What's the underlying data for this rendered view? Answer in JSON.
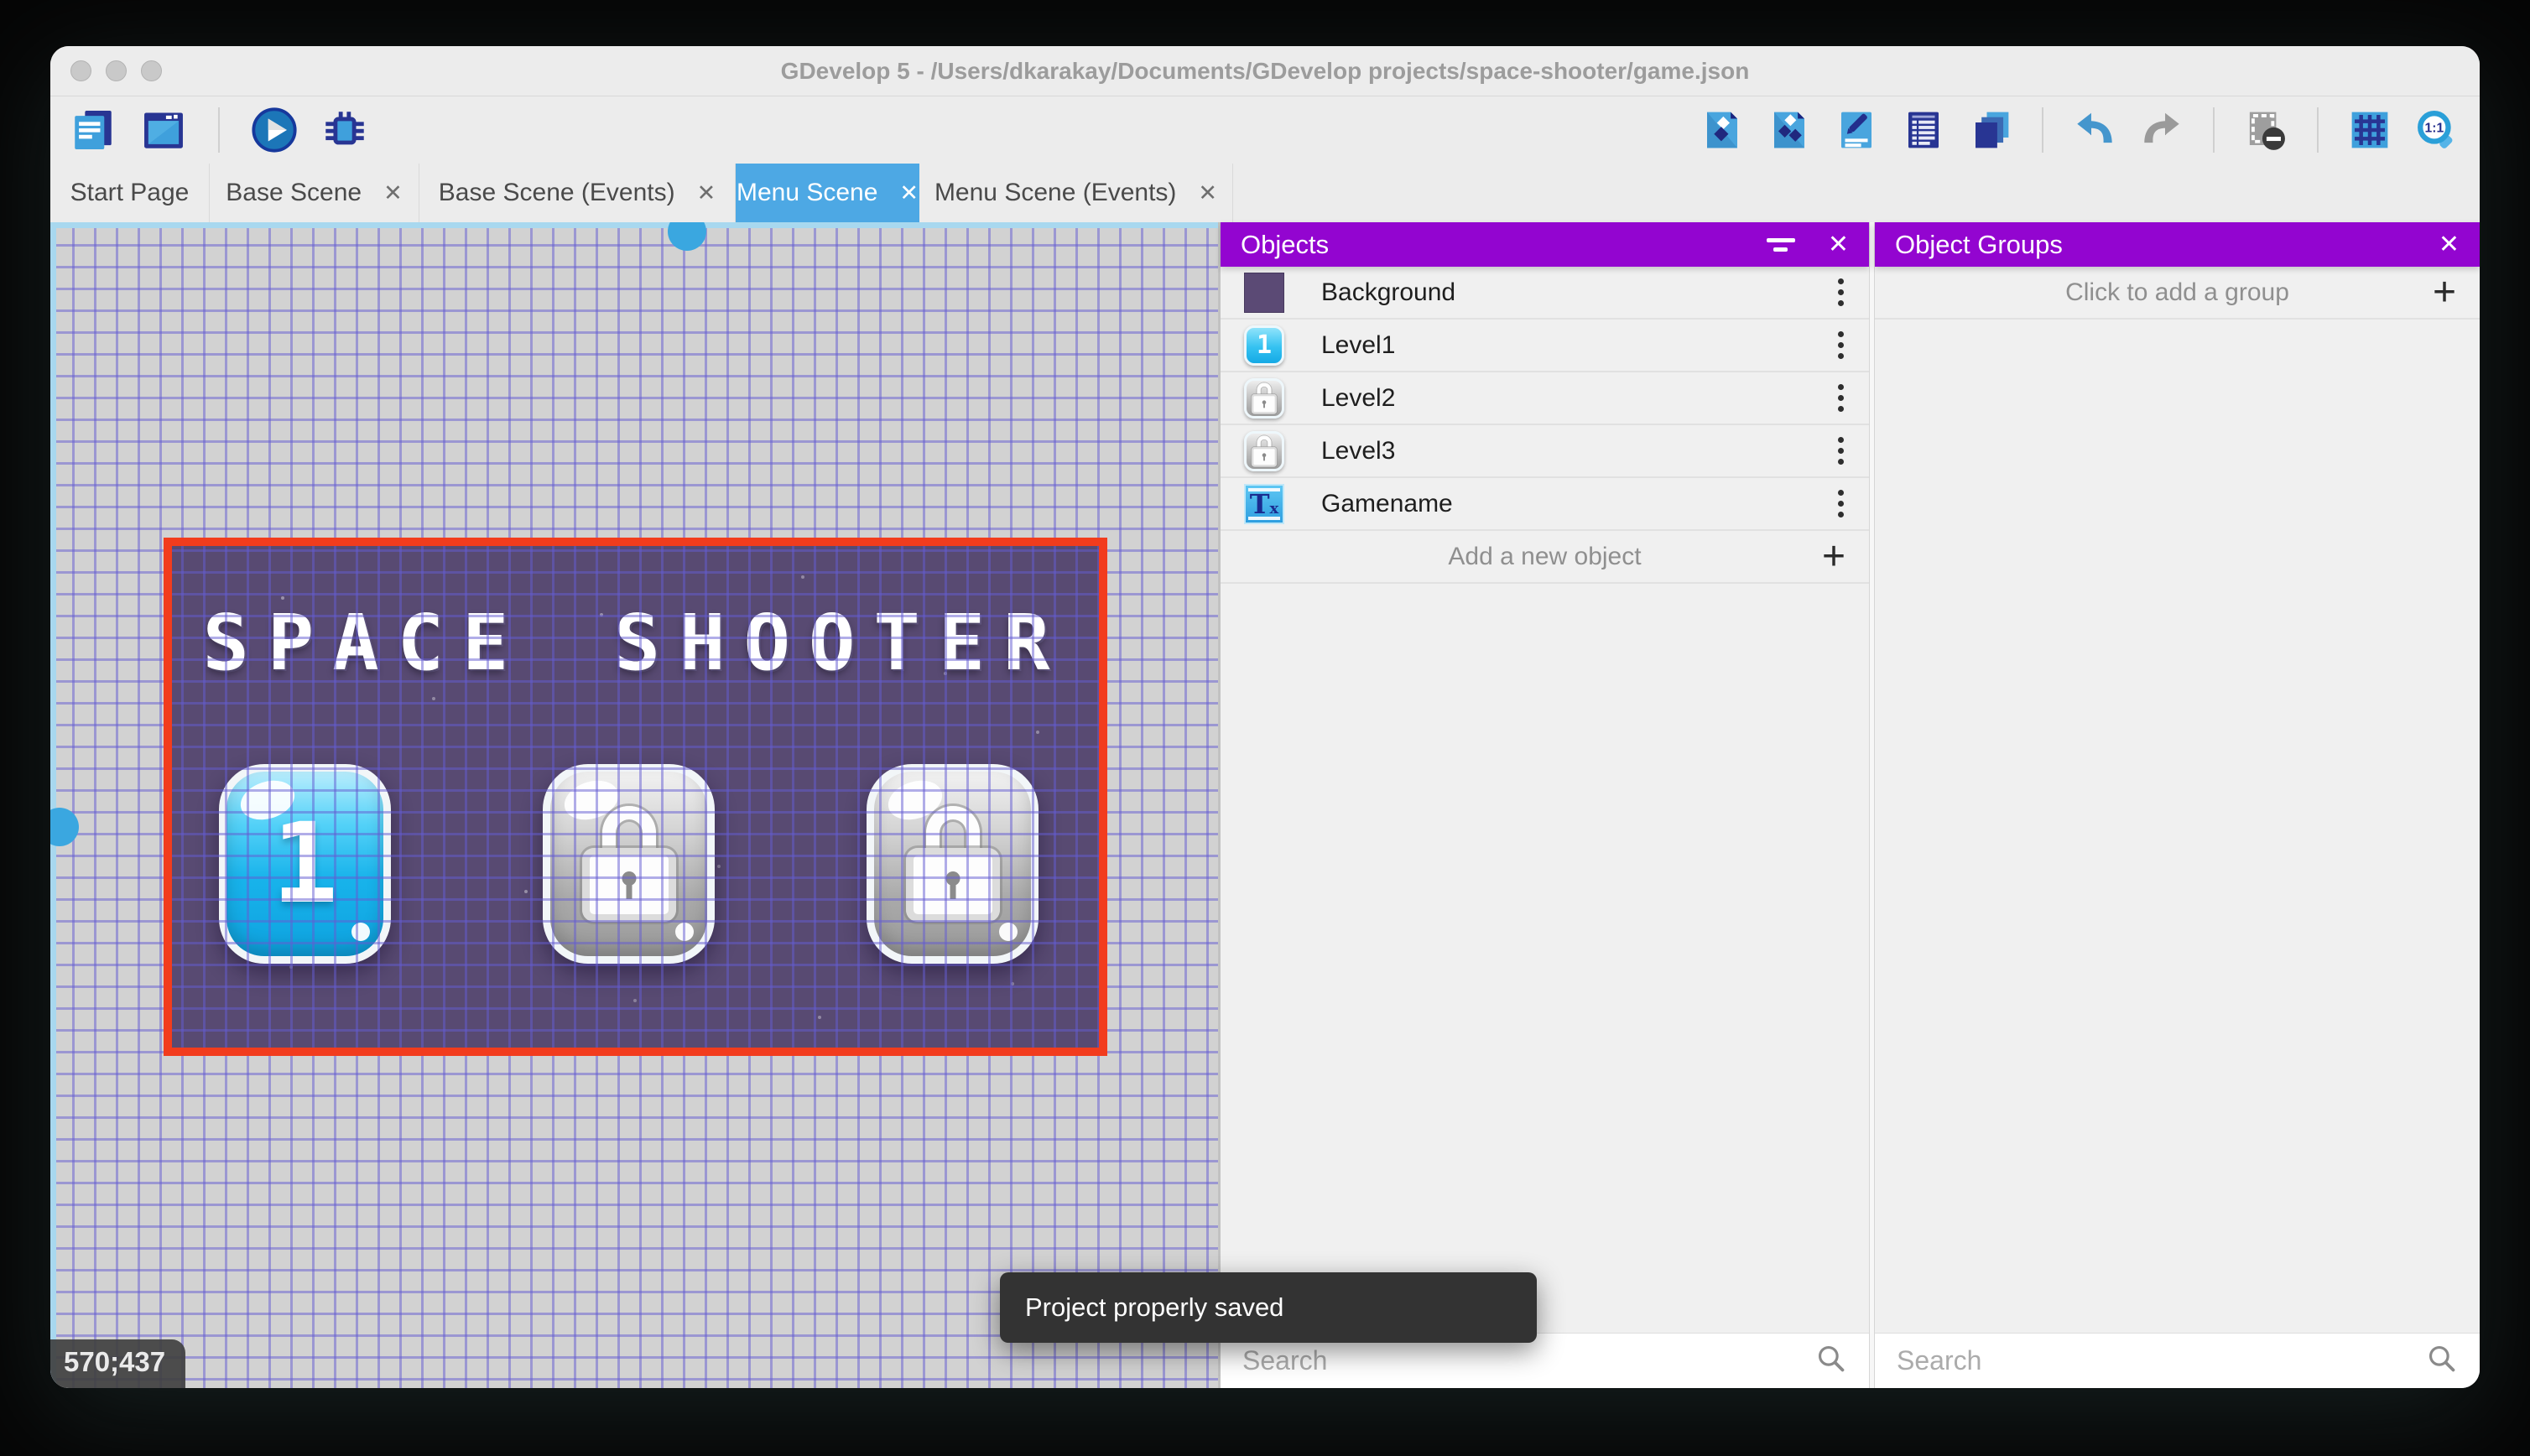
{
  "window": {
    "title": "GDevelop 5 - /Users/dkarakay/Documents/GDevelop projects/space-shooter/game.json"
  },
  "glyphs": {
    "close": "✕",
    "plus": "+"
  },
  "toolbar": {
    "left_icons": [
      "project-manager-icon",
      "start-page-icon",
      "play-icon",
      "debug-icon"
    ],
    "right_icons": [
      "objects-editor-icon",
      "object-groups-icon",
      "properties-icon",
      "instances-list-icon",
      "layers-icon",
      "undo-icon",
      "redo-icon",
      "mask-icon",
      "grid-icon",
      "zoom-original-icon"
    ]
  },
  "tabs": [
    {
      "label": "Start Page",
      "active": false,
      "closable": false
    },
    {
      "label": "Base Scene",
      "active": false,
      "closable": true
    },
    {
      "label": "Base Scene (Events)",
      "active": false,
      "closable": true
    },
    {
      "label": "Menu Scene",
      "active": true,
      "closable": true
    },
    {
      "label": "Menu Scene (Events)",
      "active": false,
      "closable": true
    }
  ],
  "canvas": {
    "coordinates": "570;437",
    "toast": "Project properly saved",
    "scene": {
      "title": "SPACE SHOOTER",
      "buttons": [
        {
          "label": "1",
          "locked": false
        },
        {
          "label": "",
          "locked": true
        },
        {
          "label": "",
          "locked": true
        }
      ]
    }
  },
  "objects_panel": {
    "title": "Objects",
    "items": [
      {
        "name": "Background",
        "thumb": "background-color-swatch"
      },
      {
        "name": "Level1",
        "thumb": "blue-button",
        "badge": "1"
      },
      {
        "name": "Level2",
        "thumb": "locked-button"
      },
      {
        "name": "Level3",
        "thumb": "locked-button"
      },
      {
        "name": "Gamename",
        "thumb": "text-object",
        "badge_main": "T",
        "badge_sub": "x"
      }
    ],
    "add_label": "Add a new object",
    "search_placeholder": "Search"
  },
  "groups_panel": {
    "title": "Object Groups",
    "add_label": "Click to add a group",
    "search_placeholder": "Search"
  },
  "colors": {
    "panel_header_purple": "#9305D0",
    "active_tab_blue": "#4DA8E4",
    "scene_border_red": "#F23C1D",
    "scene_background_purple": "#584A72",
    "grid_line": "#645CD2",
    "toolbar_icon_blue": "#3FA0DC",
    "toolbar_icon_navy": "#283593",
    "scrollbar_blue": "#3AA7E0"
  }
}
